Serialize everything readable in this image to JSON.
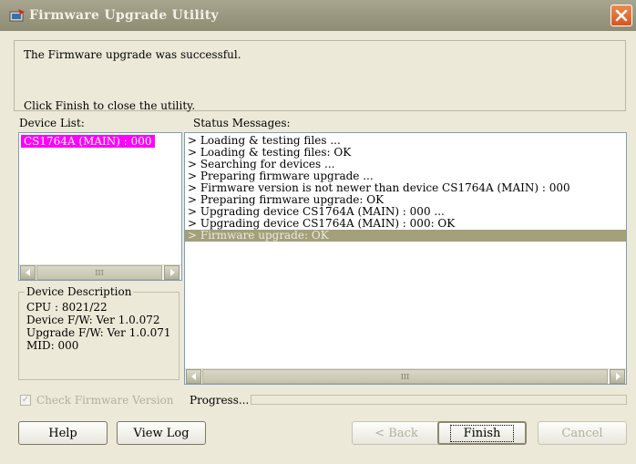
{
  "window": {
    "title": "Firmware Upgrade Utility"
  },
  "message": {
    "line1": "The Firmware upgrade was successful.",
    "line2": "Click Finish to close the utility."
  },
  "device_list": {
    "label": "Device List:",
    "items": [
      "CS1764A (MAIN) : 000"
    ]
  },
  "status": {
    "label": "Status Messages:",
    "lines": [
      "> Loading & testing files ...",
      "> Loading & testing files: OK",
      "> Searching for devices ...",
      "> Preparing firmware upgrade ...",
      "> Firmware version is not newer than device CS1764A (MAIN) : 000",
      "> Preparing firmware upgrade: OK",
      "> Upgrading device CS1764A (MAIN) : 000 ...",
      "> Upgrading device CS1764A (MAIN) : 000: OK",
      "> Firmware upgrade: OK"
    ]
  },
  "device_description": {
    "legend": "Device Description",
    "cpu": "CPU : 8021/22",
    "device_fw": "Device F/W: Ver 1.0.072",
    "upgrade_fw": "Upgrade F/W: Ver 1.0.071",
    "mid": "MID: 000"
  },
  "check_firmware": {
    "label": "Check Firmware Version",
    "checked": true
  },
  "progress": {
    "label": "Progress...",
    "value": 0
  },
  "buttons": {
    "help": "Help",
    "view_log": "View Log",
    "back": "< Back",
    "finish": "Finish",
    "cancel": "Cancel"
  },
  "scrollbar": {
    "thumb_grip": "III"
  },
  "colors": {
    "title_bar": "#9c9a82",
    "selected_device": "#ff00ff",
    "selected_status": "#a3a07a",
    "close_button": "#e0622a"
  }
}
